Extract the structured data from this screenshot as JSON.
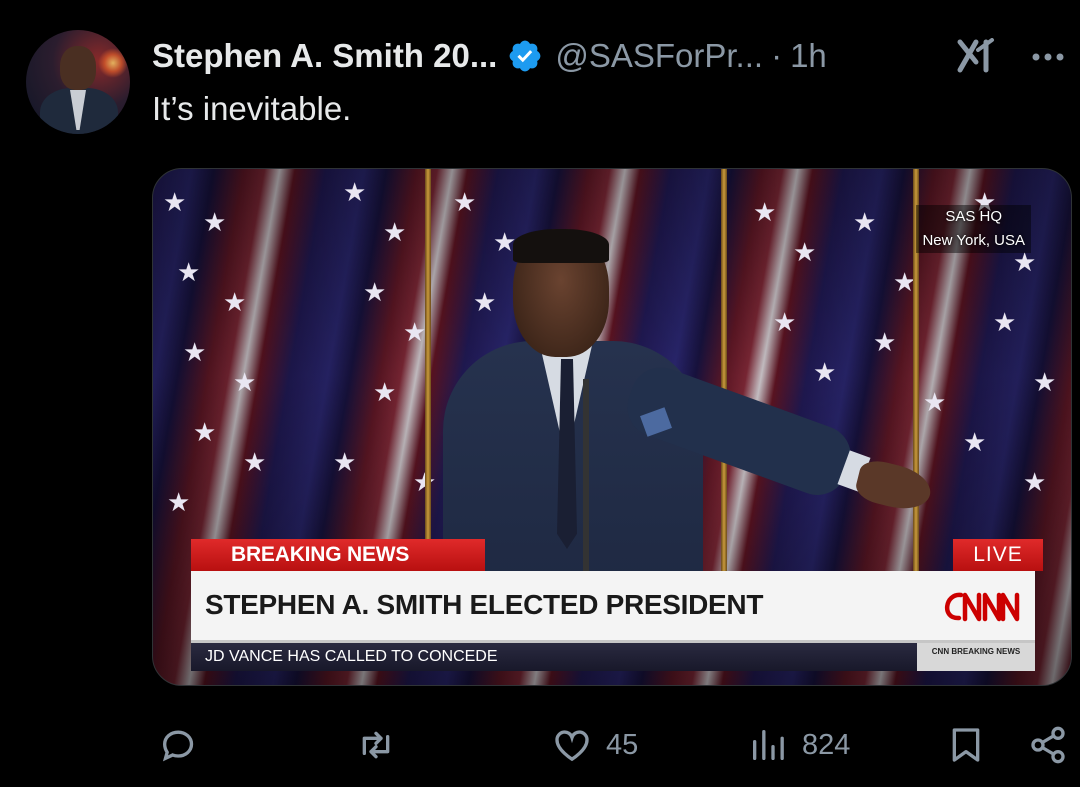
{
  "post": {
    "author_name": "Stephen A. Smith 20...",
    "handle": "@SASForPr...",
    "separator": "·",
    "time": "1h",
    "text": "It’s inevitable."
  },
  "media": {
    "location_line1": "SAS HQ",
    "location_line2": "New York, USA",
    "breaking_label": "BREAKING NEWS",
    "live_label": "LIVE",
    "headline": "STEPHEN A. SMITH ELECTED PRESIDENT",
    "network_logo": "CNN",
    "ticker": "JD VANCE HAS CALLED TO CONCEDE",
    "ticker_badge": "CNN BREAKING NEWS"
  },
  "actions": {
    "reply_icon": "reply-icon",
    "repost_icon": "repost-icon",
    "like_count": "45",
    "views_count": "824"
  },
  "colors": {
    "background": "#000000",
    "text": "#e7e9ea",
    "muted": "#8b98a5",
    "verified": "#1d9bf0",
    "breaking_red": "#cc1a1a"
  }
}
